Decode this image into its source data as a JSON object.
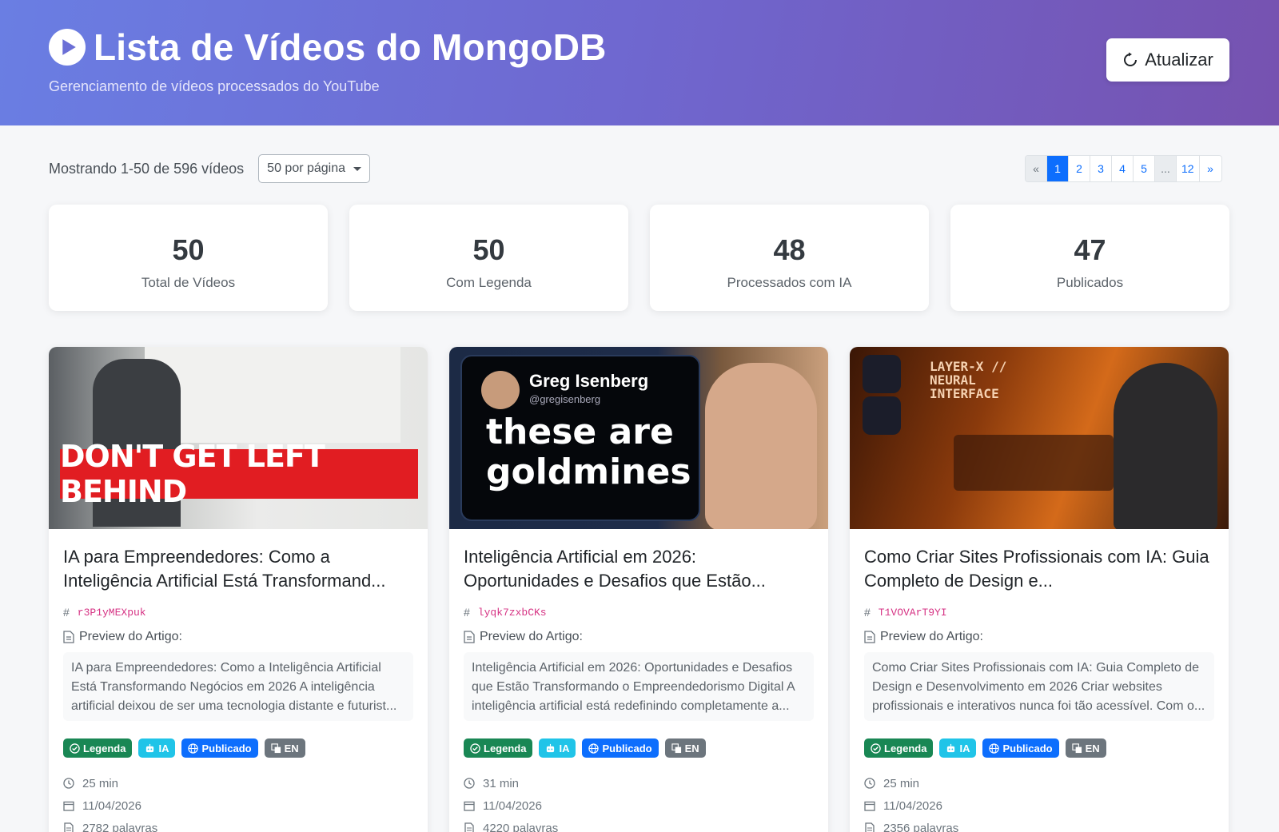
{
  "header": {
    "title": "Lista de Vídeos do MongoDB",
    "subtitle": "Gerenciamento de vídeos processados do YouTube",
    "refresh_label": "Atualizar"
  },
  "toolbar": {
    "showing_text": "Mostrando 1-50 de 596 vídeos",
    "per_page_value": "50 por página"
  },
  "pagination": {
    "prev": "«",
    "pages": [
      "1",
      "2",
      "3",
      "4",
      "5"
    ],
    "ellipsis": "...",
    "last": "12",
    "next": "»",
    "active_page": "1"
  },
  "stats": [
    {
      "value": "50",
      "label": "Total de Vídeos"
    },
    {
      "value": "50",
      "label": "Com Legenda"
    },
    {
      "value": "48",
      "label": "Processados com IA"
    },
    {
      "value": "47",
      "label": "Publicados"
    }
  ],
  "badge_labels": {
    "legenda": "Legenda",
    "ia": "IA",
    "publicado": "Publicado",
    "lang": "EN"
  },
  "preview_label": "Preview do Artigo:",
  "videos": [
    {
      "thumbnail_text": "DON'T GET LEFT BEHIND",
      "title": "IA para Empreendedores: Como a Inteligência Artificial Está Transformand...",
      "id": "r3P1yMEXpuk",
      "preview": "IA para Empreendedores: Como a Inteligência Artificial Está Transformando Negócios em 2026 A inteligência artificial deixou de ser uma tecnologia distante e futurist...",
      "duration": "25 min",
      "date": "11/04/2026",
      "words": "2782 palavras"
    },
    {
      "thumbnail_text": "these are goldmines",
      "thumbnail_name": "Greg Isenberg",
      "thumbnail_handle": "@gregisenberg",
      "title": "Inteligência Artificial em 2026: Oportunidades e Desafios que Estão...",
      "id": "lyqk7zxbCKs",
      "preview": "Inteligência Artificial em 2026: Oportunidades e Desafios que Estão Transformando o Empreendedorismo Digital A inteligência artificial está redefinindo completamente a...",
      "duration": "31 min",
      "date": "11/04/2026",
      "words": "4220 palavras"
    },
    {
      "thumbnail_text": "LAYER-X // NEURAL INTERFACE",
      "title": "Como Criar Sites Profissionais com IA: Guia Completo de Design e...",
      "id": "T1VOVArT9YI",
      "preview": "Como Criar Sites Profissionais com IA: Guia Completo de Design e Desenvolvimento em 2026 Criar websites profissionais e interativos nunca foi tão acessível. Com o...",
      "duration": "25 min",
      "date": "11/04/2026",
      "words": "2356 palavras"
    }
  ],
  "colors": {
    "header_gradient_start": "#6a7ee3",
    "header_gradient_end": "#7652b0",
    "primary": "#0d6efd",
    "success": "#198754",
    "info": "#20c4e8",
    "secondary": "#6c757d"
  }
}
